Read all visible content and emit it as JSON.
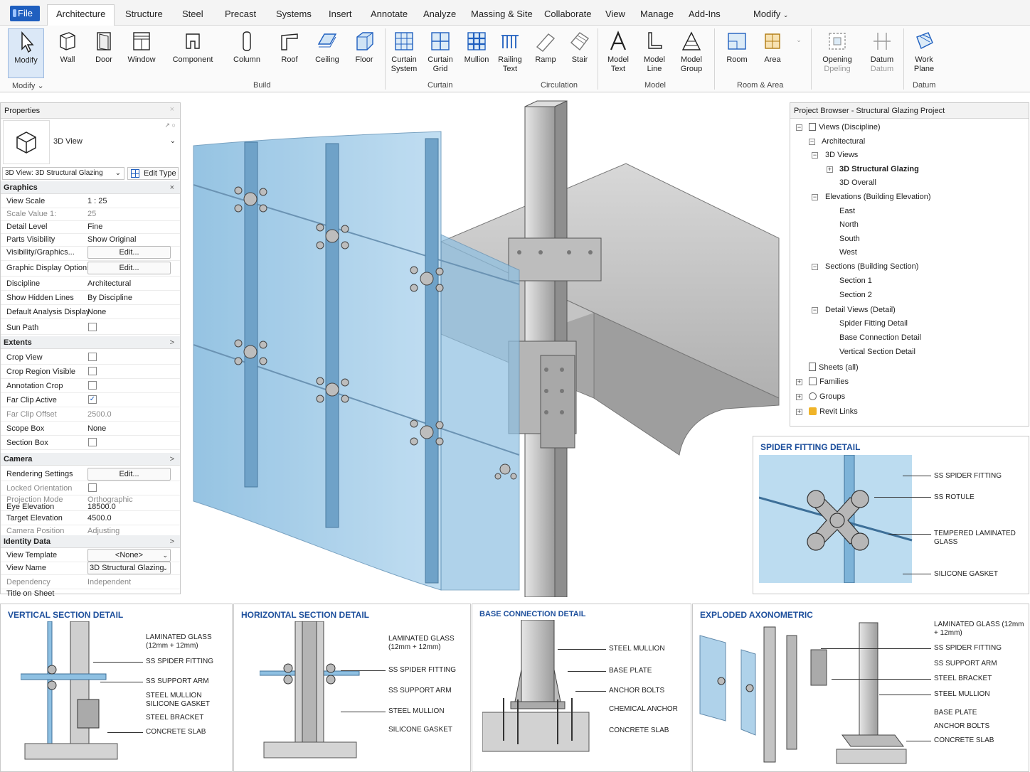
{
  "tabs": {
    "file": "File",
    "items": [
      "Architecture",
      "Structure",
      "Steel",
      "Precast",
      "Systems",
      "Insert",
      "Annotate",
      "Analyze",
      "Massing & Site",
      "Collaborate",
      "View",
      "Manage",
      "Add-Ins"
    ],
    "modify": "Modify"
  },
  "ribbon": {
    "modify": "Modify",
    "select": "Modify",
    "wall": "Wall",
    "door": "Door",
    "window": "Window",
    "component": "Component",
    "column": "Column",
    "roof": "Roof",
    "ceiling": "Ceiling",
    "floor": "Floor",
    "curtain_system": "Curtain System",
    "curtain_grid": "Curtain Grid",
    "mullion": "Mullion",
    "railing_text": "Railing Text",
    "ramp": "Ramp",
    "stair": "Stair",
    "model_text": "Model Text",
    "model_line": "Model Line",
    "model_group": "Model Group",
    "room": "Room",
    "area": "Area",
    "opening": "Opening",
    "opening_sub": "Dpeling",
    "datum": "Datum",
    "datum_sub": "Datum",
    "work_plane": "Work Plane",
    "groups": {
      "build": "Build",
      "curtain": "Curtain",
      "circulation": "Circulation",
      "model": "Model",
      "room_area": "Room & Area",
      "datum": "Datum"
    }
  },
  "properties": {
    "title": "Properties",
    "type_name": "3D View",
    "selector": "3D View: 3D Structural Glazing",
    "edit_type": "Edit Type",
    "sections": {
      "graphics": "Graphics",
      "extents": "Extents",
      "camera": "Camera",
      "identity": "Identity Data"
    },
    "rows": {
      "view_scale_k": "View Scale",
      "view_scale_v": "1 : 25",
      "scale_value_k": "Scale Value    1:",
      "scale_value_v": "25",
      "detail_level_k": "Detail Level",
      "detail_level_v": "Fine",
      "parts_vis_k": "Parts Visibility",
      "parts_vis_v": "Show Original",
      "vg_k": "Visibility/Graphics...",
      "vg_v": "Edit...",
      "gdo_k": "Graphic Display Options",
      "gdo_v": "Edit...",
      "discipline_k": "Discipline",
      "discipline_v": "Architectural",
      "hidden_k": "Show Hidden Lines",
      "hidden_v": "By Discipline",
      "analysis_k": "Default Analysis Display",
      "analysis_v": "None",
      "sun_k": "Sun Path",
      "crop_k": "Crop View",
      "crop_vis_k": "Crop Region Visible",
      "anno_crop_k": "Annotation Crop",
      "far_clip_k": "Far Clip Active",
      "far_off_k": "Far Clip Offset",
      "far_off_v": "2500.0",
      "scope_k": "Scope Box",
      "scope_v": "None",
      "section_box_k": "Section Box",
      "render_k": "Rendering Settings",
      "render_v": "Edit...",
      "locked_k": "Locked Orientation",
      "proj_k": "Projection Mode",
      "proj_v": "Orthographic",
      "eye_k": "Eye Elevation",
      "eye_v": "18500.0",
      "target_k": "Target Elevation",
      "target_v": "4500.0",
      "campos_k": "Camera Position",
      "campos_v": "Adjusting",
      "template_k": "View Template",
      "template_v": "<None>",
      "viewname_k": "View Name",
      "viewname_v": "3D Structural Glazing",
      "dependency_k": "Dependency",
      "dependency_v": "Independent",
      "title_sheet_k": "Title on Sheet"
    }
  },
  "browser": {
    "title": "Project Browser - Structural Glazing Project",
    "nodes": {
      "views": "Views (Discipline)",
      "arch": "Architectural",
      "v3d": "3D Views",
      "v3d_struct": "3D Structural Glazing",
      "v3d_overall": "3D Overall",
      "elev": "Elevations (Building Elevation)",
      "east": "East",
      "north": "North",
      "south": "South",
      "west": "West",
      "sections": "Sections (Building Section)",
      "s1": "Section 1",
      "s2": "Section 2",
      "details": "Detail Views (Detail)",
      "d1": "Spider Fitting Detail",
      "d2": "Base Connection Detail",
      "d3": "Vertical Section Detail",
      "sheets": "Sheets (all)",
      "families": "Families",
      "groups": "Groups",
      "links": "Revit Links"
    }
  },
  "details": {
    "spider": {
      "title": "SPIDER FITTING DETAIL",
      "labels": [
        "SS SPIDER FITTING",
        "SS ROTULE",
        "TEMPERED LAMINATED GLASS",
        "SILICONE GASKET"
      ]
    },
    "vertical": {
      "title": "VERTICAL SECTION DETAIL",
      "labels": [
        "LAMINATED GLASS (12mm + 12mm)",
        "SS SPIDER FITTING",
        "SS SUPPORT ARM",
        "STEEL MULLION",
        "SILICONE GASKET",
        "STEEL BRACKET",
        "CONCRETE SLAB"
      ]
    },
    "horizontal": {
      "title": "HORIZONTAL SECTION DETAIL",
      "labels": [
        "LAMINATED GLASS (12mm + 12mm)",
        "SS SPIDER FITTING",
        "SS SUPPORT ARM",
        "STEEL MULLION",
        "SILICONE GASKET"
      ]
    },
    "base": {
      "title": "BASE CONNECTION DETAIL",
      "labels": [
        "STEEL MULLION",
        "BASE PLATE",
        "ANCHOR BOLTS",
        "CHEMICAL ANCHOR",
        "CONCRETE SLAB"
      ]
    },
    "exploded": {
      "title": "EXPLODED AXONOMETRIC",
      "labels": [
        "LAMINATED GLASS (12mm + 12mm)",
        "SS SPIDER FITTING",
        "SS SUPPORT ARM",
        "STEEL BRACKET",
        "STEEL MULLION",
        "BASE PLATE",
        "ANCHOR BOLTS",
        "CONCRETE SLAB"
      ]
    }
  },
  "colors": {
    "accent": "#1f5fbf",
    "glass": "#9cc8e6",
    "steel": "#b9b9b9",
    "concrete": "#c8c8c8",
    "title_blue": "#1d4f9c"
  }
}
